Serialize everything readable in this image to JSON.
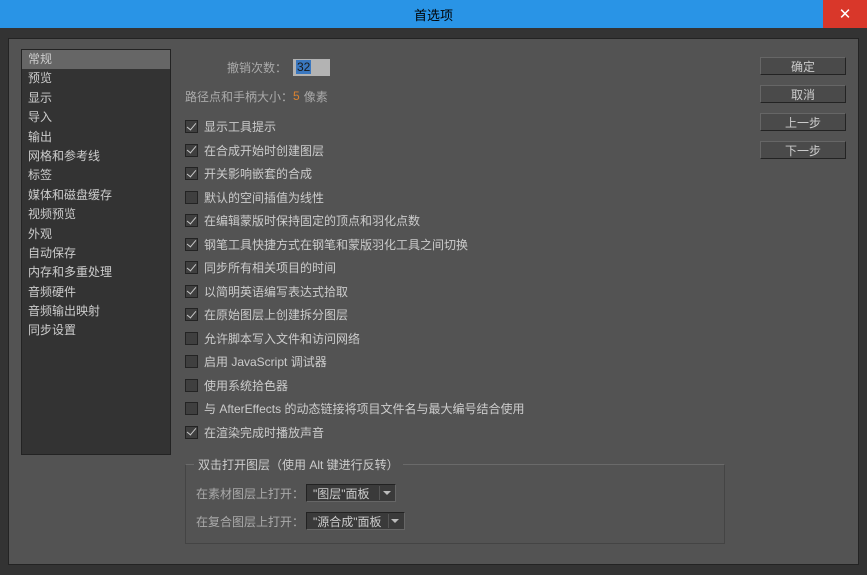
{
  "title": "首选项",
  "buttons": {
    "ok": "确定",
    "cancel": "取消",
    "prev": "上一步",
    "next": "下一步"
  },
  "sidebar": {
    "items": [
      "常规",
      "预览",
      "显示",
      "导入",
      "输出",
      "网格和参考线",
      "标签",
      "媒体和磁盘缓存",
      "视频预览",
      "外观",
      "自动保存",
      "内存和多重处理",
      "音频硬件",
      "音频输出映射",
      "同步设置"
    ],
    "selected": 0
  },
  "fields": {
    "undo_label": "撤销次数：",
    "undo_value": "32",
    "path_size_label": "路径点和手柄大小：",
    "path_size_value": "5",
    "path_size_suffix": "像素"
  },
  "checkboxes": [
    {
      "label": "显示工具提示",
      "checked": true
    },
    {
      "label": "在合成开始时创建图层",
      "checked": true
    },
    {
      "label": "开关影响嵌套的合成",
      "checked": true
    },
    {
      "label": "默认的空间插值为线性",
      "checked": false
    },
    {
      "label": "在编辑蒙版时保持固定的顶点和羽化点数",
      "checked": true
    },
    {
      "label": "钢笔工具快捷方式在钢笔和蒙版羽化工具之间切换",
      "checked": true
    },
    {
      "label": "同步所有相关项目的时间",
      "checked": true
    },
    {
      "label": "以简明英语编写表达式拾取",
      "checked": true
    },
    {
      "label": "在原始图层上创建拆分图层",
      "checked": true
    },
    {
      "label": "允许脚本写入文件和访问网络",
      "checked": false
    },
    {
      "label": "启用 JavaScript 调试器",
      "checked": false
    },
    {
      "label": "使用系统拾色器",
      "checked": false
    },
    {
      "label": "与 AfterEffects 的动态链接将项目文件名与最大编号结合使用",
      "checked": false
    },
    {
      "label": "在渲染完成时播放声音",
      "checked": true
    }
  ],
  "fieldset": {
    "legend": "双击打开图层（使用 Alt 键进行反转）",
    "row1_label": "在素材图层上打开：",
    "row1_value": "\"图层\"面板",
    "row2_label": "在复合图层上打开：",
    "row2_value": "\"源合成\"面板"
  }
}
